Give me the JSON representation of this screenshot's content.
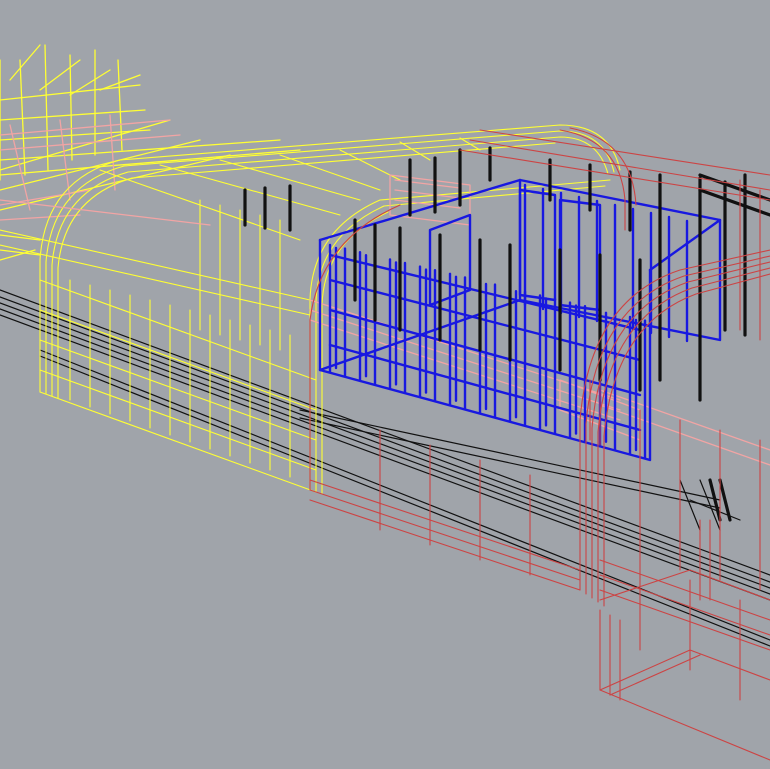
{
  "viewport": {
    "view": "perspective",
    "display_mode": "wireframe",
    "background_color": "#a0a4aa"
  },
  "layers": [
    {
      "key": "yellow_shell",
      "color": "#ffff33"
    },
    {
      "key": "pink_shell",
      "color": "#f2a4a4"
    },
    {
      "key": "red_shell",
      "color": "#cc4444"
    },
    {
      "key": "blue_frame",
      "color": "#1818e0"
    },
    {
      "key": "black_members",
      "color": "#111111"
    }
  ]
}
